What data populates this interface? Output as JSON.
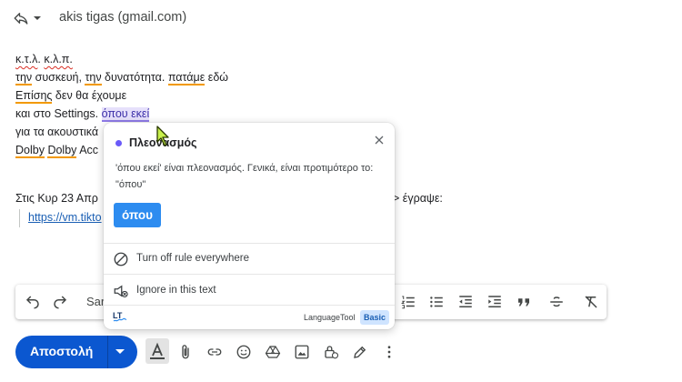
{
  "header": {
    "reply_icon": "reply-icon",
    "recipient": "akis tigas (gmail.com)"
  },
  "body": {
    "line1": {
      "a": "κ.τ.λ",
      "b": ". ",
      "c": "κ.λ.π."
    },
    "line2": {
      "a": "την",
      "b": " συσκευή, ",
      "c": "την",
      "d": " δυνατότητα. ",
      "e": "πατάμε",
      "f": " εδώ"
    },
    "line3": {
      "a": "Επίσης",
      "b": " δεν θα έχουμε"
    },
    "line4": {
      "a": "και στο Settings. ",
      "b": "όπου εκεί"
    },
    "line5": {
      "a": "για τα ακουστικά"
    },
    "line6": {
      "a": "Dolby",
      "b": " ",
      "c": "Dolby",
      "d": " Acc"
    }
  },
  "quote": {
    "header": "Στις Κυρ 23 Απρ",
    "header_tail": "> έγραψε:",
    "link": "https://vm.tikto"
  },
  "toolbar": {
    "font_label": "Sar"
  },
  "bottom": {
    "send_label": "Αποστολή"
  },
  "popup": {
    "dot_color": "#6a5af9",
    "title": "Πλεονασμός",
    "message": "'όπου εκεί' είναι πλεονασμός. Γενικά, είναι προτιμότερο το: \"όπου\"",
    "suggestion": "όπου",
    "action_turn_off": "Turn off rule everywhere",
    "action_ignore": "Ignore in this text",
    "brand": "LanguageTool",
    "badge": "Basic"
  },
  "colors": {
    "send_blue": "#0b57d0",
    "suggestion_blue": "#2d8cf0",
    "spell_red": "#d93025",
    "grammar_orange": "#f29900",
    "highlight_purple": "#e6e0fb"
  }
}
